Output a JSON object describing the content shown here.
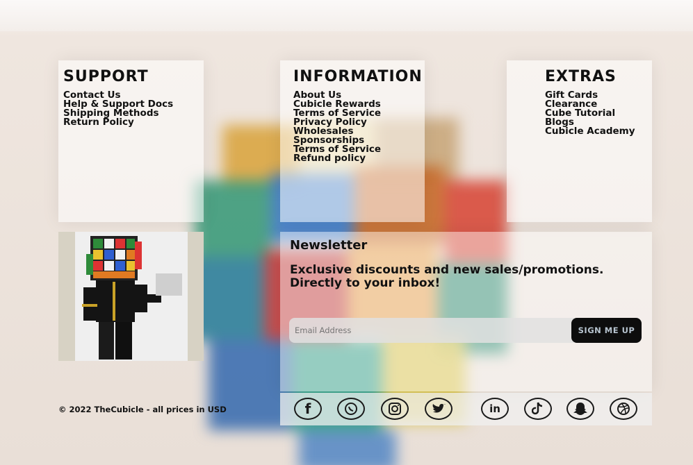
{
  "support": {
    "title": "SUPPORT",
    "links": [
      "Contact Us",
      "Help & Support Docs",
      "Shipping Methods",
      "Return Policy"
    ]
  },
  "information": {
    "title": "INFORMATION",
    "links": [
      "About Us",
      "Cubicle Rewards",
      "Terms of Service",
      "Privacy Policy",
      "Wholesales",
      "Sponsorships",
      "Terms of Service",
      "Refund policy"
    ]
  },
  "extras": {
    "title": "EXTRAS",
    "links": [
      "Gift Cards",
      "Clearance",
      "Cube Tutorial",
      "Blogs",
      "Cubicle Academy"
    ]
  },
  "newsletter": {
    "title": "Newsletter",
    "subtitle": "Exclusive discounts and new sales/promotions. Directly to your inbox!",
    "email_placeholder": "Email Address",
    "button_label": "SIGN ME UP"
  },
  "footer": {
    "copyright": "© 2022 TheCubicle - all prices in USD"
  },
  "social": {
    "icons": [
      "facebook-icon",
      "whatsapp-icon",
      "instagram-icon",
      "twitter-icon",
      "linkedin-icon",
      "tiktok-icon",
      "snapchat-icon",
      "dribbble-icon"
    ]
  },
  "colors": {
    "button_bg": "#0d0d0d",
    "button_text": "#b7c4cf"
  }
}
